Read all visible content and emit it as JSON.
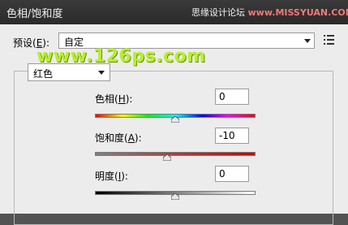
{
  "window": {
    "title": "色相/饱和度",
    "watermark_top": "思缘设计论坛",
    "watermark_top_url": "www.MISSYUAN.COM",
    "watermark_main": "www.126ps.com"
  },
  "preset": {
    "label_prefix": "预设(",
    "label_key": "E",
    "label_suffix": "):",
    "value": "自定",
    "options_icon": "list-menu-icon"
  },
  "channel": {
    "value": "红色"
  },
  "sliders": {
    "hue": {
      "label_prefix": "色相(",
      "key": "H",
      "label_suffix": "):",
      "value": "0",
      "level": 0
    },
    "saturation": {
      "label_prefix": "饱和度(",
      "key": "A",
      "label_suffix": "):",
      "value": "-10",
      "level": -10
    },
    "lightness": {
      "label_prefix": "明度(",
      "key": "I",
      "label_suffix": "):",
      "value": "0",
      "level": 0
    }
  },
  "colors": {
    "title_bar": "#2e2e2e",
    "panel": "#ececec",
    "watermark": "#b6ef2c"
  }
}
